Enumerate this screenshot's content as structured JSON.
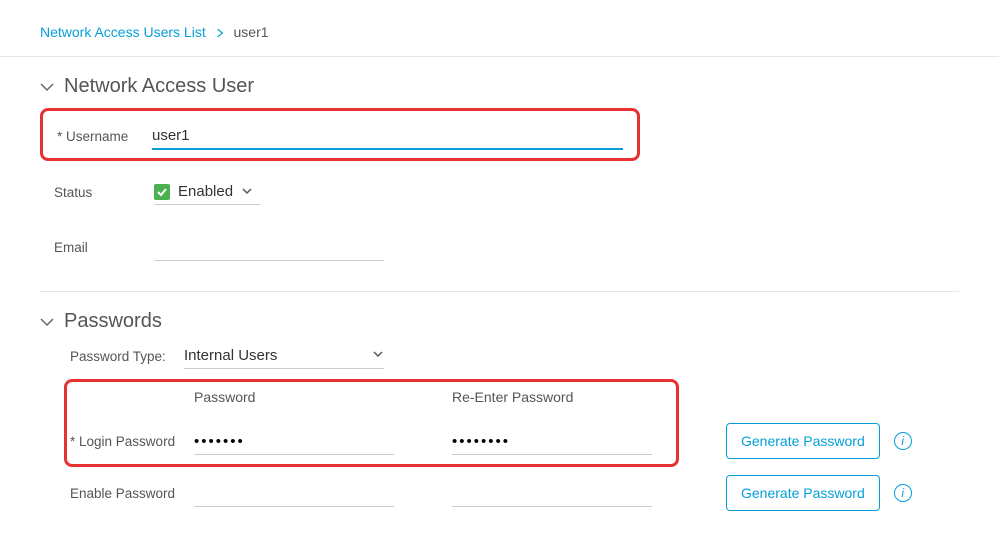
{
  "breadcrumb": {
    "parent": "Network Access Users List",
    "current": "user1"
  },
  "sections": {
    "user": {
      "title": "Network Access User",
      "username_label": "Username",
      "username_value": "user1",
      "status_label": "Status",
      "status_value": "Enabled",
      "email_label": "Email",
      "email_value": ""
    },
    "passwords": {
      "title": "Passwords",
      "type_label": "Password Type:",
      "type_value": "Internal Users",
      "col_password": "Password",
      "col_reenter": "Re-Enter Password",
      "login_label": "Login Password",
      "login_pw": "•••••••",
      "login_pw_re": "••••••••",
      "enable_label": "Enable Password",
      "enable_pw": "",
      "enable_pw_re": "",
      "generate_btn": "Generate Password"
    }
  }
}
